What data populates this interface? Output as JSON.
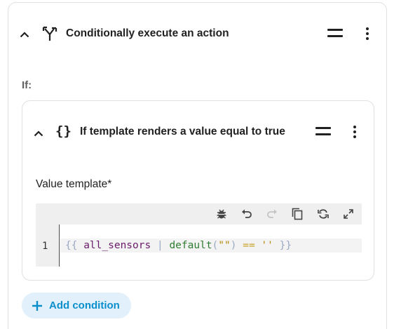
{
  "action": {
    "title": "Conditionally execute an action",
    "icons": {
      "collapse": "chevron-up-icon",
      "type": "source-branch-icon",
      "drag": "drag-handle-icon",
      "menu": "dots-vertical-icon"
    }
  },
  "if_label": "If:",
  "condition": {
    "title": "If template renders a value equal to true",
    "icon_glyph": "{}",
    "field_label": "Value template*",
    "editor": {
      "line_number": "1",
      "tokens": [
        {
          "t": "{{",
          "c": "brace"
        },
        {
          "t": " ",
          "c": "plain"
        },
        {
          "t": "all_sensors",
          "c": "var"
        },
        {
          "t": " ",
          "c": "plain"
        },
        {
          "t": "|",
          "c": "pipe"
        },
        {
          "t": " ",
          "c": "plain"
        },
        {
          "t": "default",
          "c": "filter"
        },
        {
          "t": "(",
          "c": "paren"
        },
        {
          "t": "\"\"",
          "c": "str"
        },
        {
          "t": ")",
          "c": "paren"
        },
        {
          "t": " ",
          "c": "plain"
        },
        {
          "t": "==",
          "c": "op"
        },
        {
          "t": " ",
          "c": "plain"
        },
        {
          "t": "''",
          "c": "str"
        },
        {
          "t": " ",
          "c": "plain"
        },
        {
          "t": "}}",
          "c": "brace"
        }
      ],
      "toolbar": [
        "bug-icon",
        "undo-icon",
        "redo-icon",
        "copy-icon",
        "autorenew-icon",
        "fullscreen-icon"
      ]
    }
  },
  "add_condition": {
    "label": "Add condition"
  },
  "colors": {
    "accent": "#0a8fcc",
    "accent_bg": "#e1f0fa",
    "border": "#e0e0e0",
    "editor_bg": "#efefef"
  }
}
